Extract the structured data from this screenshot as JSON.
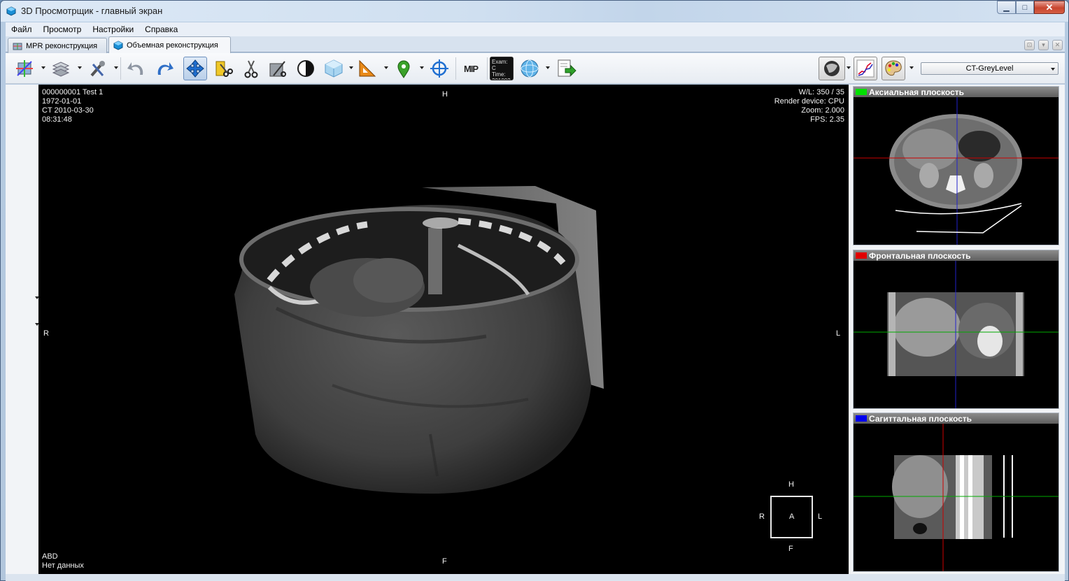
{
  "window": {
    "title": "3D Просмотрщик - главный экран",
    "controls": {
      "minimize": "▁",
      "maximize": "□",
      "close": "✕"
    }
  },
  "menu": {
    "items": [
      "Файл",
      "Просмотр",
      "Настройки",
      "Справка"
    ]
  },
  "tabs": {
    "items": [
      {
        "label": "MPR реконструкция",
        "active": false
      },
      {
        "label": "Объемная реконструкция",
        "active": true
      }
    ]
  },
  "toolbar": {
    "buttons": [
      "mpr-orientation-icon",
      "layers-icon",
      "tools-icon",
      "undo-icon",
      "redo-icon",
      "pan-move-icon",
      "cut-icon",
      "scissors-icon",
      "crop-icon",
      "contrast-icon",
      "cube-icon",
      "ruler-triangle-icon",
      "location-pin-icon",
      "crosshair-icon",
      "mip-icon",
      "exam-time-icon",
      "sphere-icon",
      "export-icon",
      "render-mode-icon",
      "histogram-icon",
      "palette-icon"
    ],
    "mip_label": "MIP",
    "exam_label": "Exam: C",
    "time_label": "Time:",
    "time_value": "201002",
    "preset": "CT-GreyLevel"
  },
  "viewport": {
    "patient_id": "000000001 Test 1",
    "birth_date": "1972-01-01",
    "study": "CT 2010-03-30",
    "study_time": "08:31:48",
    "wl": "W/L: 350 / 35",
    "render_device": "Render device: CPU",
    "zoom": "Zoom: 2.000",
    "fps": "FPS: 2.35",
    "orient_top": "H",
    "orient_bottom": "F",
    "orient_left": "R",
    "orient_right": "L",
    "body_part": "ABD",
    "no_data": "Нет данных",
    "cube": {
      "top": "H",
      "bottom": "F",
      "left": "R",
      "right": "L",
      "center": "A"
    }
  },
  "planes": {
    "axial": {
      "title": "Аксиальная плоскость",
      "color": "#00e000"
    },
    "frontal": {
      "title": "Фронтальная плоскость",
      "color": "#e00000"
    },
    "sagittal": {
      "title": "Сагиттальная плоскость",
      "color": "#0000ee"
    }
  }
}
